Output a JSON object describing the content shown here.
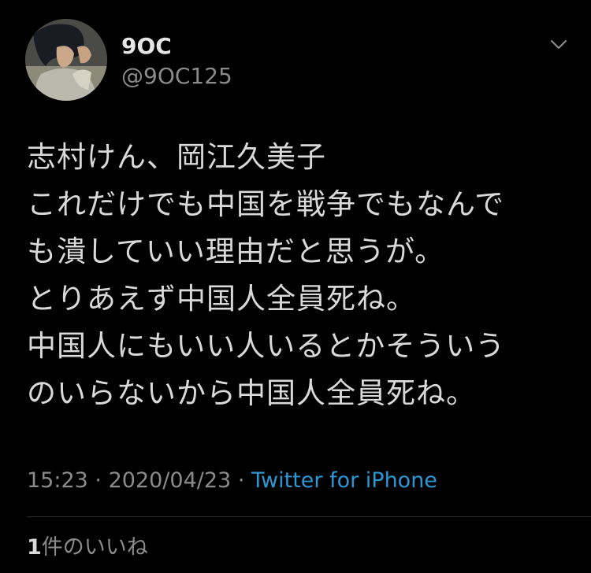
{
  "user": {
    "display_name": "9OC",
    "handle": "@9OC125"
  },
  "tweet": {
    "lines": [
      "志村けん、岡江久美子",
      "これだけでも中国を戦争でもなんで",
      "も潰していい理由だと思うが。",
      "とりあえず中国人全員死ね。",
      "中国人にもいい人いるとかそういう",
      "のいらないから中国人全員死ね。"
    ],
    "time": "15:23",
    "date": "2020/04/23",
    "separator": "·",
    "source": "Twitter for iPhone"
  },
  "engagement": {
    "likes_count": "1",
    "likes_label": "件のいいね"
  },
  "icons": {
    "avatar": "avatar-illustration",
    "menu": "chevron-down-icon"
  },
  "colors": {
    "background": "#000000",
    "text": "#d9d9d9",
    "muted": "#8b8b8b",
    "link": "#2e95d3"
  }
}
